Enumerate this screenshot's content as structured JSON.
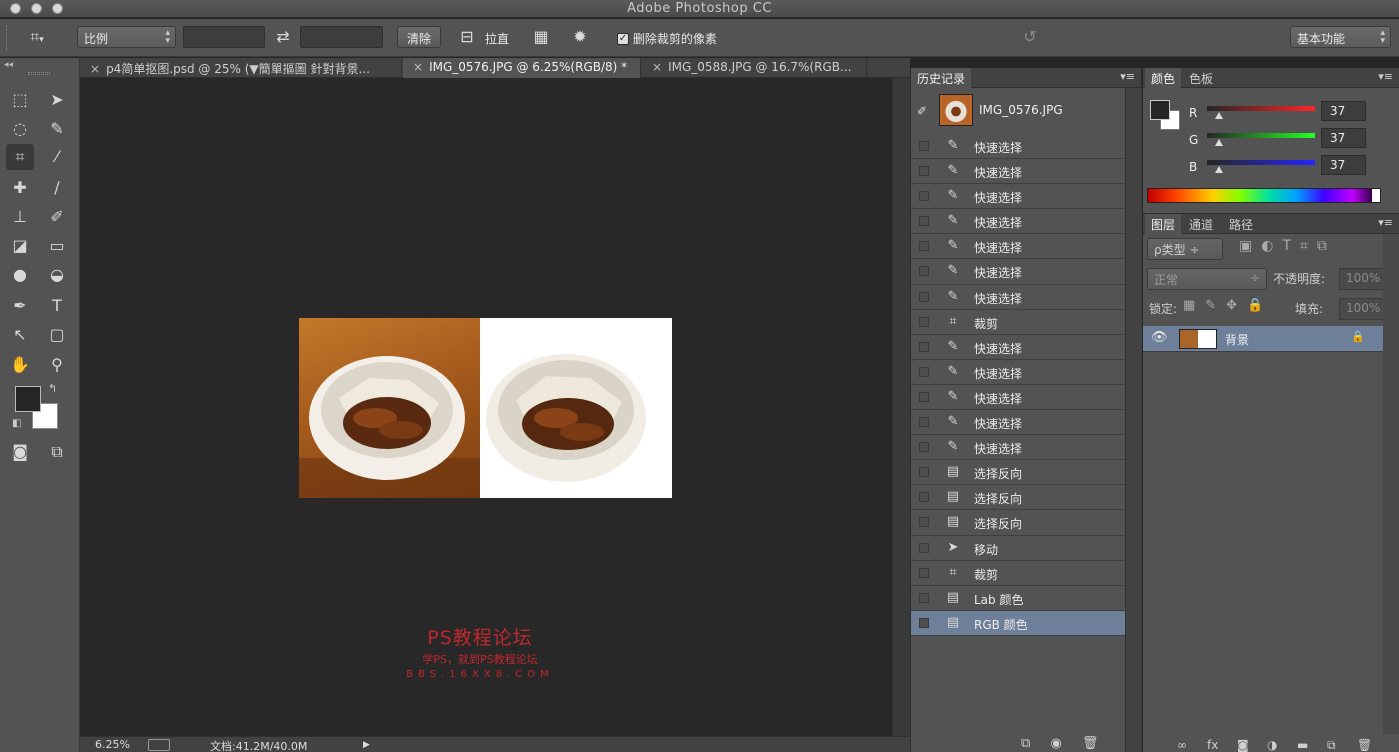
{
  "window": {
    "title": "Adobe Photoshop CC"
  },
  "options_bar": {
    "ratio_select": "比例",
    "clear_button": "清除",
    "straighten_label": "拉直",
    "delete_cropped_label": "删除裁剪的像素",
    "delete_cropped_checked": true,
    "workspace_select": "基本功能"
  },
  "tabs": [
    {
      "label": "p4简单抠图.psd @ 25% (▼簡單摳圖 針對背景...",
      "active": false
    },
    {
      "label": "IMG_0576.JPG @ 6.25%(RGB/8) *",
      "active": true
    },
    {
      "label": "IMG_0588.JPG @ 16.7%(RGB...",
      "active": false
    }
  ],
  "status_bar": {
    "zoom": "6.25%",
    "doc_size": "文档:41.2M/40.0M"
  },
  "watermark": {
    "line1": "PS教程论坛",
    "line2": "学PS，就到PS教程论坛",
    "line3": "BBS.16XX8.COM",
    "color": "#c0272d"
  },
  "history": {
    "tab_label": "历史记录",
    "snapshot_name": "IMG_0576.JPG",
    "items": [
      {
        "label": "快速选择",
        "icon": "quick-selection-icon"
      },
      {
        "label": "快速选择",
        "icon": "quick-selection-icon"
      },
      {
        "label": "快速选择",
        "icon": "quick-selection-icon"
      },
      {
        "label": "快速选择",
        "icon": "quick-selection-icon"
      },
      {
        "label": "快速选择",
        "icon": "quick-selection-icon"
      },
      {
        "label": "快速选择",
        "icon": "quick-selection-icon"
      },
      {
        "label": "快速选择",
        "icon": "quick-selection-icon"
      },
      {
        "label": "裁剪",
        "icon": "crop-icon"
      },
      {
        "label": "快速选择",
        "icon": "quick-selection-icon"
      },
      {
        "label": "快速选择",
        "icon": "quick-selection-icon"
      },
      {
        "label": "快速选择",
        "icon": "quick-selection-icon"
      },
      {
        "label": "快速选择",
        "icon": "quick-selection-icon"
      },
      {
        "label": "快速选择",
        "icon": "quick-selection-icon"
      },
      {
        "label": "选择反向",
        "icon": "document-icon"
      },
      {
        "label": "选择反向",
        "icon": "document-icon"
      },
      {
        "label": "选择反向",
        "icon": "document-icon"
      },
      {
        "label": "移动",
        "icon": "move-icon"
      },
      {
        "label": "裁剪",
        "icon": "crop-icon"
      },
      {
        "label": "Lab 颜色",
        "icon": "document-icon"
      },
      {
        "label": "RGB 颜色",
        "icon": "document-icon",
        "selected": true
      }
    ]
  },
  "color_panel": {
    "tab_color": "颜色",
    "tab_swatches": "色板",
    "r_label": "R",
    "g_label": "G",
    "b_label": "B",
    "r_value": "37",
    "g_value": "37",
    "b_value": "37",
    "foreground": "#252525",
    "background": "#ffffff"
  },
  "layers_panel": {
    "tab_layers": "图层",
    "tab_channels": "通道",
    "tab_paths": "路径",
    "filter_select": "ρ类型",
    "blend_mode": "正常",
    "opacity_label": "不透明度:",
    "opacity_value": "100%",
    "lock_label": "锁定:",
    "fill_label": "填充:",
    "fill_value": "100%",
    "layers": [
      {
        "name": "背景",
        "visible": true,
        "locked": true,
        "selected": true
      }
    ]
  },
  "colors": {
    "selection": "#6e7f99",
    "panel": "#535353",
    "canvas": "#282828"
  }
}
